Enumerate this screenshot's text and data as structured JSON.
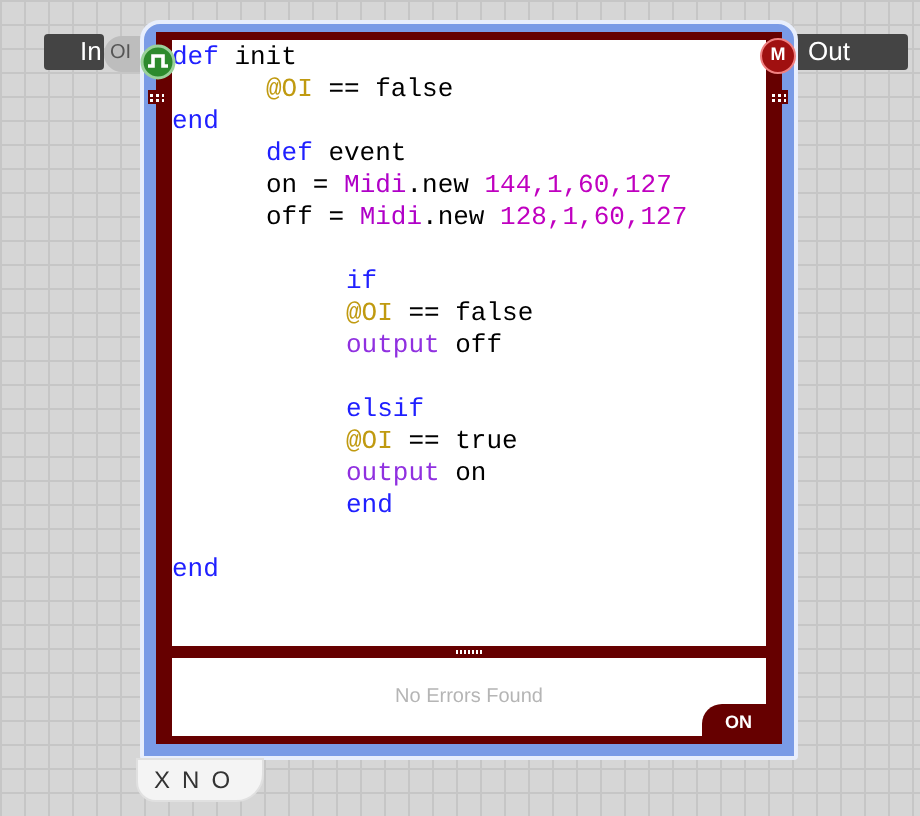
{
  "inputs": [
    {
      "label": "In",
      "port_label": "OI"
    }
  ],
  "outputs": [
    {
      "label": "Out",
      "port_glyph": "M"
    }
  ],
  "code": {
    "lines": [
      {
        "kind": "code",
        "tokens": [
          {
            "kind": "keyword",
            "text": "def"
          },
          {
            "kind": "plain",
            "text": " init"
          }
        ]
      },
      {
        "kind": "block",
        "children": [
          {
            "kind": "code",
            "tokens": [
              {
                "kind": "ivar",
                "text": "@OI"
              },
              {
                "kind": "plain",
                "text": " == false"
              }
            ]
          }
        ]
      },
      {
        "kind": "code",
        "tokens": [
          {
            "kind": "keyword",
            "text": "end"
          }
        ]
      },
      {
        "kind": "block",
        "children": [
          {
            "kind": "code",
            "tokens": [
              {
                "kind": "keyword",
                "text": "def"
              },
              {
                "kind": "plain",
                "text": " event"
              }
            ]
          },
          {
            "kind": "code",
            "tokens": [
              {
                "kind": "plain",
                "text": "on = "
              },
              {
                "kind": "const",
                "text": "Midi"
              },
              {
                "kind": "plain",
                "text": ".new "
              },
              {
                "kind": "number",
                "text": "144,1,60,127"
              }
            ]
          },
          {
            "kind": "code",
            "tokens": [
              {
                "kind": "plain",
                "text": "off = "
              },
              {
                "kind": "const",
                "text": "Midi"
              },
              {
                "kind": "plain",
                "text": ".new "
              },
              {
                "kind": "number",
                "text": "128,1,60,127"
              }
            ]
          },
          {
            "kind": "blank"
          },
          {
            "kind": "block",
            "children": [
              {
                "kind": "code",
                "tokens": [
                  {
                    "kind": "keyword",
                    "text": "if"
                  }
                ]
              },
              {
                "kind": "code",
                "tokens": [
                  {
                    "kind": "ivar",
                    "text": "@OI"
                  },
                  {
                    "kind": "plain",
                    "text": " == false"
                  }
                ]
              },
              {
                "kind": "code",
                "tokens": [
                  {
                    "kind": "method",
                    "text": "output"
                  },
                  {
                    "kind": "plain",
                    "text": " off"
                  }
                ]
              },
              {
                "kind": "blank"
              },
              {
                "kind": "code",
                "tokens": [
                  {
                    "kind": "keyword",
                    "text": "elsif"
                  }
                ]
              },
              {
                "kind": "code",
                "tokens": [
                  {
                    "kind": "ivar",
                    "text": "@OI"
                  },
                  {
                    "kind": "plain",
                    "text": " == true"
                  }
                ]
              },
              {
                "kind": "code",
                "tokens": [
                  {
                    "kind": "method",
                    "text": "output"
                  },
                  {
                    "kind": "plain",
                    "text": " on"
                  }
                ]
              },
              {
                "kind": "code",
                "tokens": [
                  {
                    "kind": "keyword",
                    "text": "end"
                  }
                ]
              }
            ]
          }
        ]
      },
      {
        "kind": "blank"
      },
      {
        "kind": "code",
        "tokens": [
          {
            "kind": "keyword",
            "text": "end"
          }
        ]
      }
    ]
  },
  "status": "No Errors Found",
  "toggle": {
    "label": "ON",
    "on": true
  },
  "controls": [
    "X",
    "N",
    "O"
  ]
}
